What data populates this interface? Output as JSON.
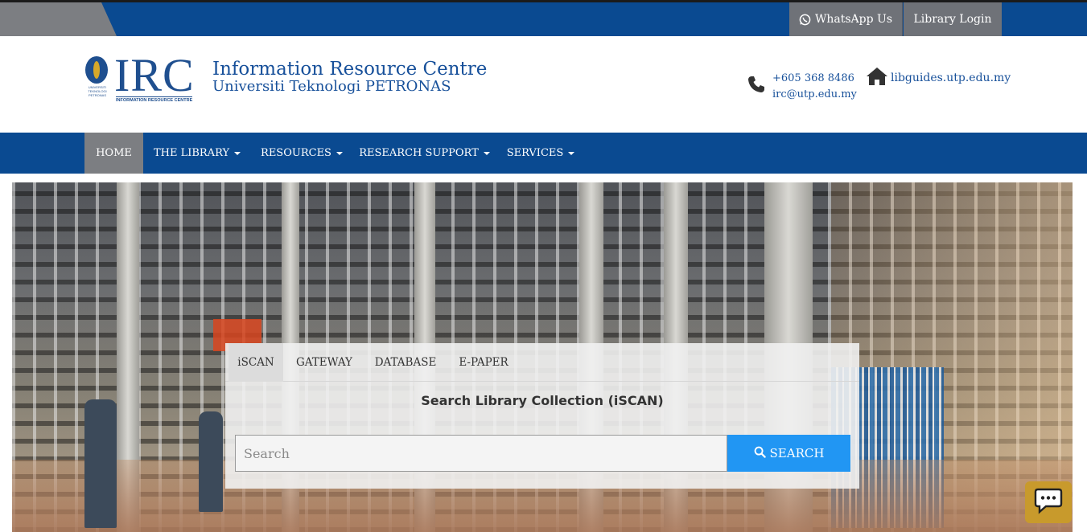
{
  "topbar": {
    "whatsapp_label": "WhatsApp Us",
    "login_label": "Library Login"
  },
  "header": {
    "logo": {
      "mark": "IRC",
      "seal_text": "UNIVERSITI TEKNOLOGI PETRONAS",
      "sub": "INFORMATION RESOURCE CENTRE"
    },
    "title_line1": "Information Resource Centre",
    "title_line2": "Universiti Teknologi PETRONAS",
    "phone": "+605 368 8486",
    "email": "irc@utp.edu.my",
    "libguides": "libguides.utp.edu.my"
  },
  "nav": {
    "items": [
      {
        "label": "HOME"
      },
      {
        "label": "THE LIBRARY"
      },
      {
        "label": "RESOURCES"
      },
      {
        "label": "RESEARCH SUPPORT"
      },
      {
        "label": "SERVICES"
      }
    ]
  },
  "search": {
    "tabs": [
      {
        "label": "iSCAN"
      },
      {
        "label": "GATEWAY"
      },
      {
        "label": "DATABASE"
      },
      {
        "label": "E-PAPER"
      }
    ],
    "heading": "Search Library Collection (iSCAN)",
    "placeholder": "Search",
    "button_label": "SEARCH"
  },
  "colors": {
    "primary_blue": "#0a4a91",
    "nav_active": "#7c7e82",
    "link_blue": "#17509a",
    "search_button": "#2196f3",
    "chat_gold": "#c89a2c"
  },
  "icons": [
    "whatsapp-icon",
    "phone-icon",
    "home-icon",
    "search-icon",
    "chat-icon"
  ]
}
